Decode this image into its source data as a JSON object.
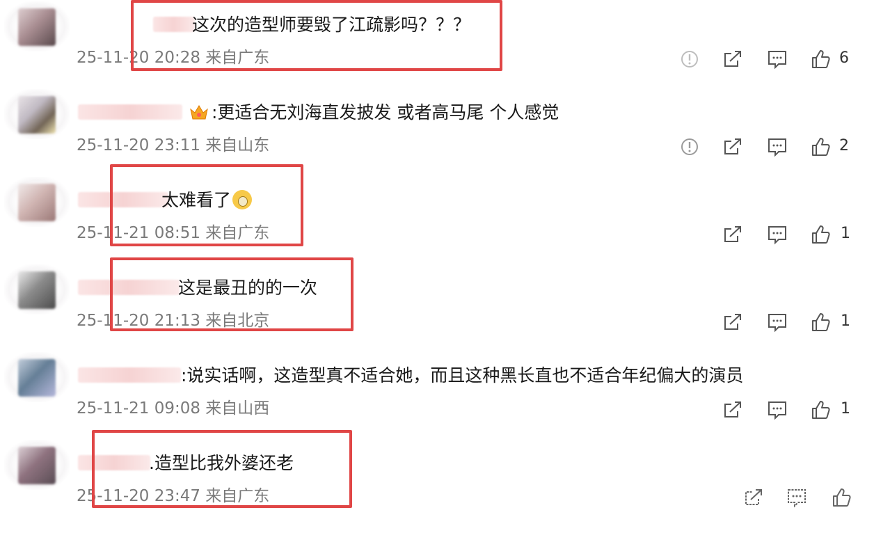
{
  "comments": [
    {
      "text": "这次的造型师要毁了江疏影吗？？？",
      "meta": "25-11-20 20:28 来自广东",
      "likes": "6",
      "has_report": true
    },
    {
      "text": ":更适合无刘海直发披发 或者高马尾 个人感觉",
      "meta": "25-11-20 23:11 来自山东",
      "likes": "2",
      "has_report": true
    },
    {
      "text": "太难看了",
      "meta": "25-11-21 08:51 来自广东",
      "likes": "1",
      "has_report": false
    },
    {
      "text": "这是最丑的的一次",
      "meta": "25-11-20 21:13 来自北京",
      "likes": "1",
      "has_report": false
    },
    {
      "text": ":说实话啊，这造型真不适合她，而且这种黑长直也不适合年纪偏大的演员",
      "meta": "25-11-21 09:08 来自山西",
      "likes": "1",
      "has_report": false
    },
    {
      "text": ".造型比我外婆还老",
      "meta": "25-11-20 23:47 来自广东",
      "likes": "",
      "has_report": false
    }
  ],
  "highlight_color": "#e04646"
}
